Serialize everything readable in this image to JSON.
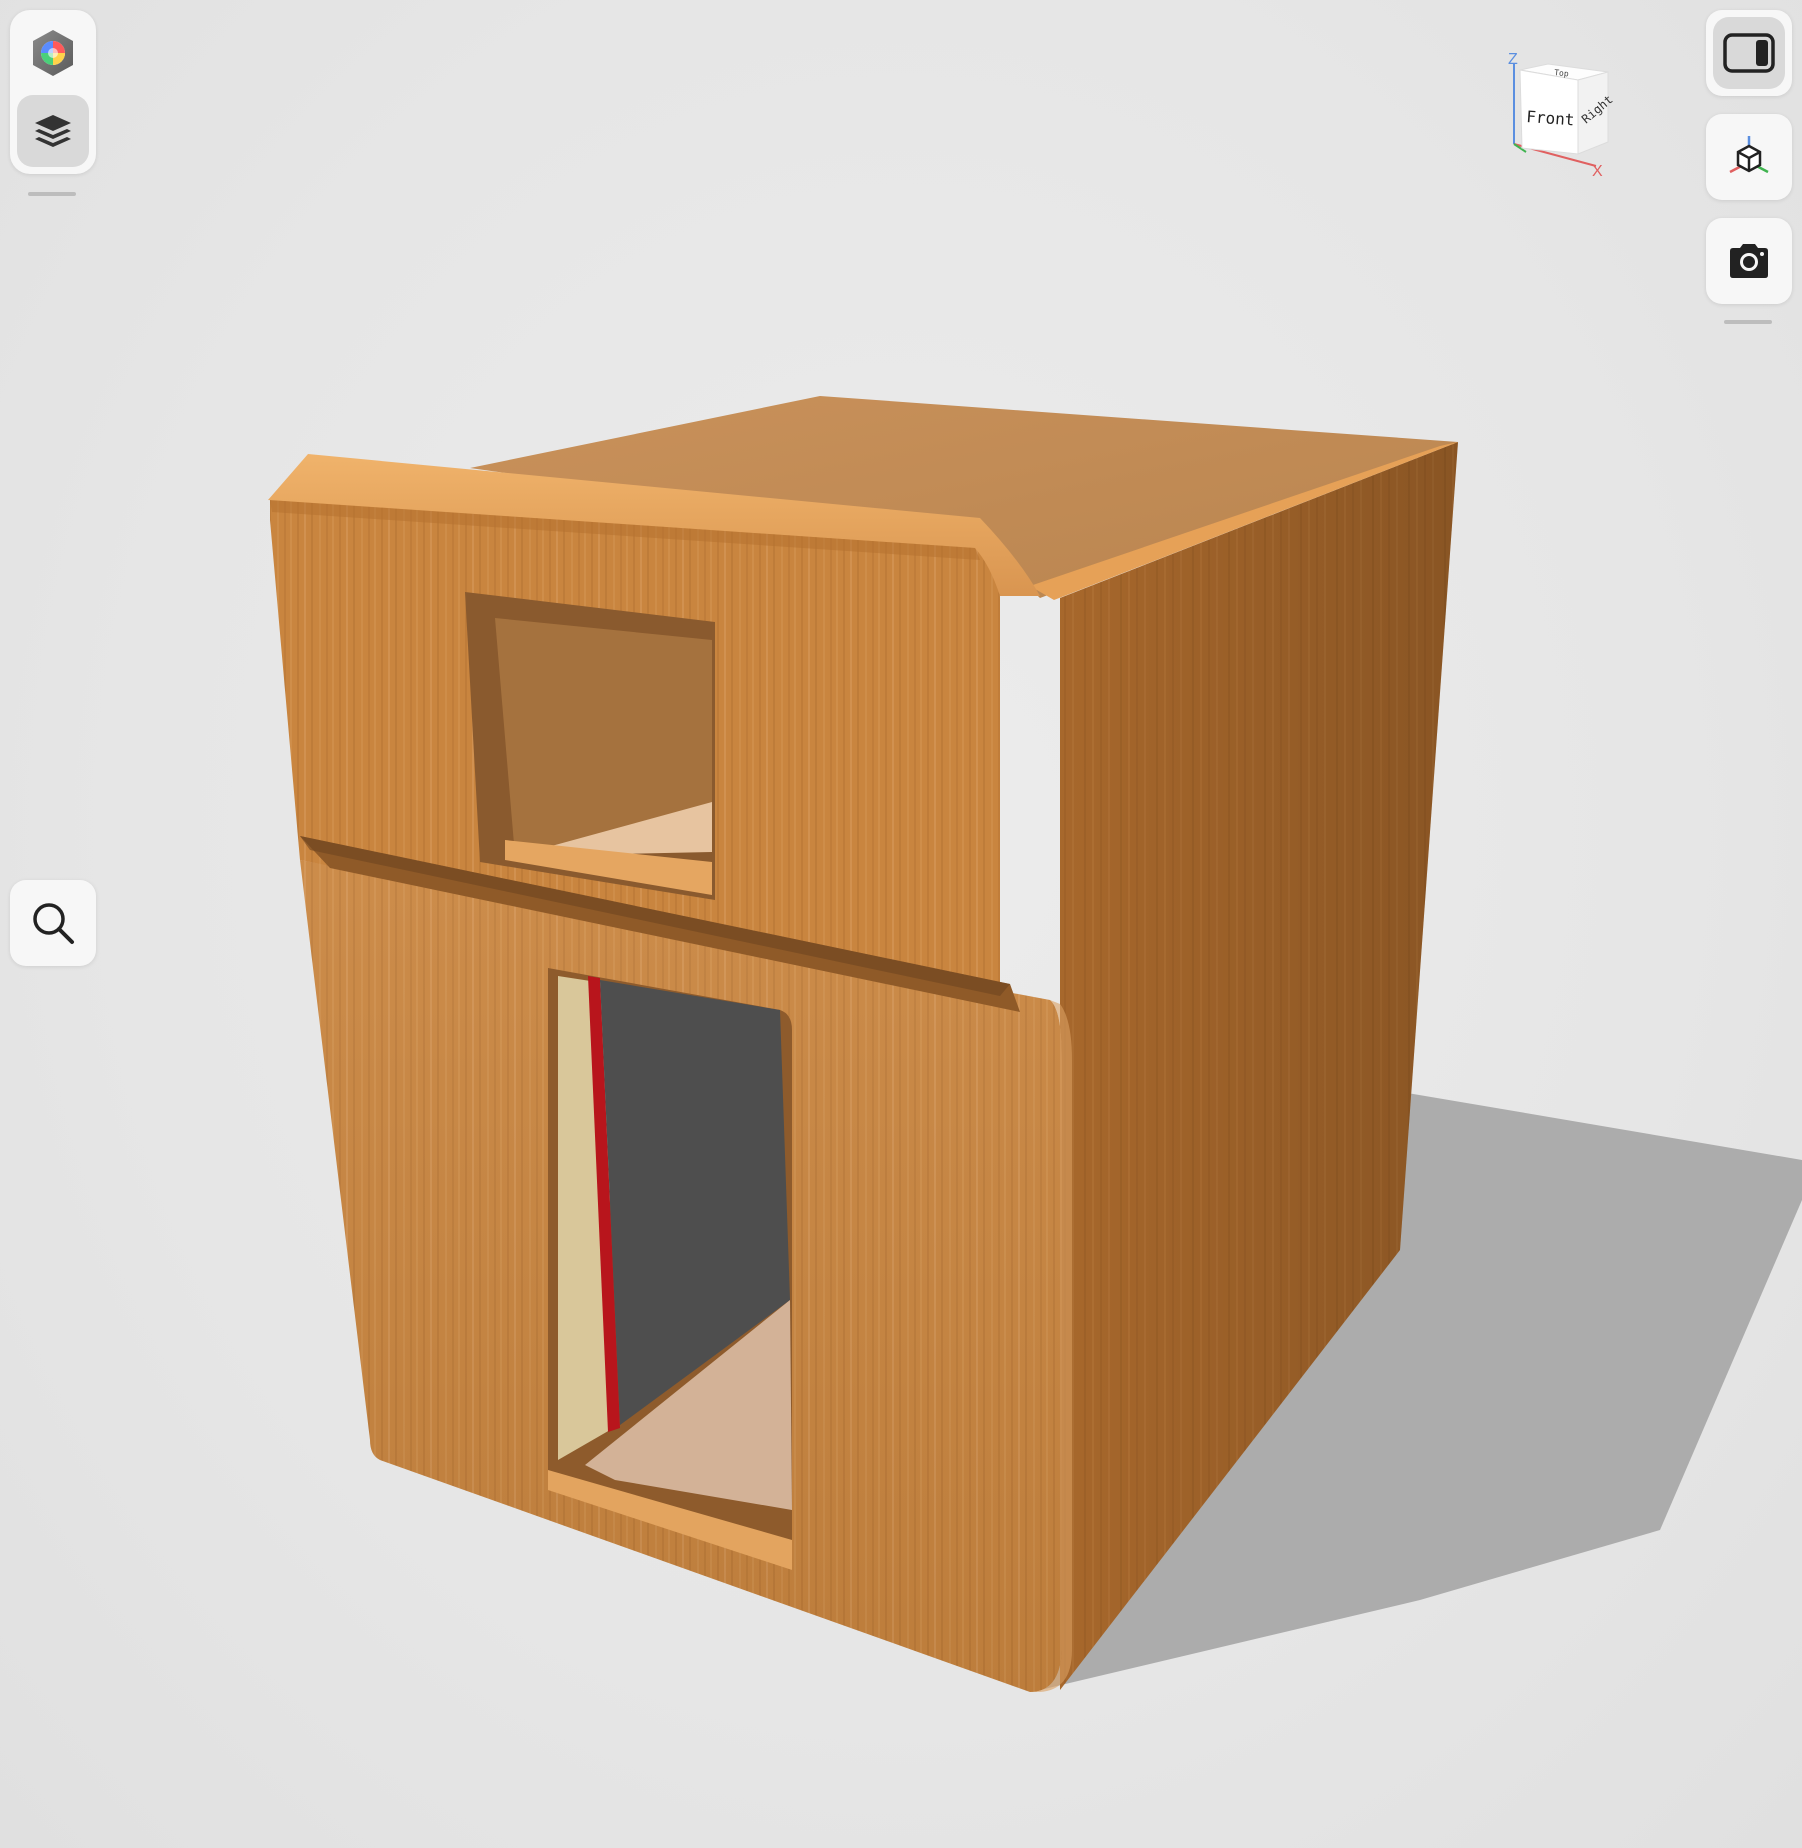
{
  "left_toolbar": {
    "appearance_icon": "color-wheel-icon",
    "layers_icon": "layers-icon",
    "search_icon": "search-icon"
  },
  "right_toolbar": {
    "panel_toggle_icon": "sidebar-toggle-icon",
    "view_icon": "3d-view-icon",
    "camera_icon": "camera-icon"
  },
  "view_cube": {
    "front": "Front",
    "right": "Right",
    "top": "Top",
    "axis_z": "Z",
    "axis_x": "X"
  },
  "colors": {
    "wood": "#c9853f",
    "wood_light": "#e0a35c",
    "wood_side": "#b46f2e",
    "background": "#e8e8e8",
    "axis_x": "#e06060",
    "axis_y": "#3fb34f",
    "axis_z": "#5b8fe0",
    "accent_red": "#b8151c"
  }
}
